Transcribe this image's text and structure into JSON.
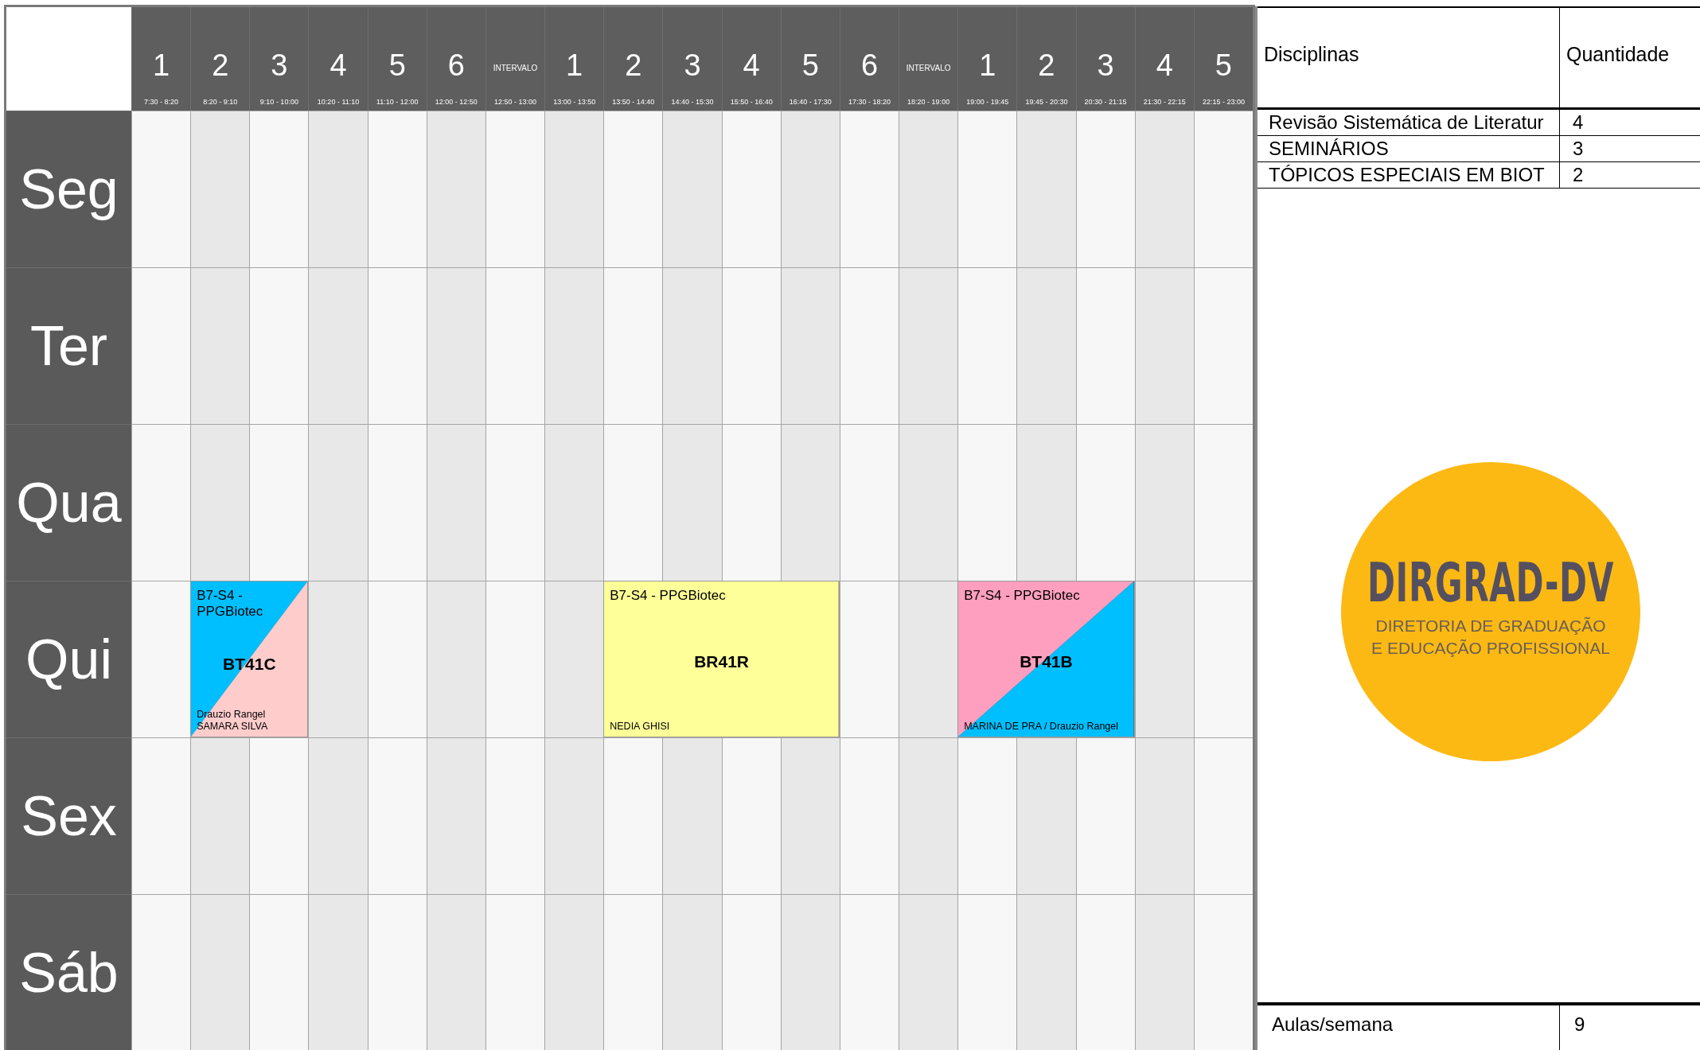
{
  "periods": [
    {
      "kind": "slot",
      "number": "1",
      "time": "7:30 - 8:20"
    },
    {
      "kind": "slot",
      "number": "2",
      "time": "8:20 - 9:10"
    },
    {
      "kind": "slot",
      "number": "3",
      "time": "9:10 - 10:00"
    },
    {
      "kind": "slot",
      "number": "4",
      "time": "10:20 - 11:10"
    },
    {
      "kind": "slot",
      "number": "5",
      "time": "11:10 - 12:00"
    },
    {
      "kind": "slot",
      "number": "6",
      "time": "12:00 - 12:50"
    },
    {
      "kind": "break",
      "label": "INTERVALO",
      "time": "12:50 - 13:00"
    },
    {
      "kind": "slot",
      "number": "1",
      "time": "13:00 - 13:50"
    },
    {
      "kind": "slot",
      "number": "2",
      "time": "13:50 - 14:40"
    },
    {
      "kind": "slot",
      "number": "3",
      "time": "14:40 - 15:30"
    },
    {
      "kind": "slot",
      "number": "4",
      "time": "15:50 - 16:40"
    },
    {
      "kind": "slot",
      "number": "5",
      "time": "16:40 - 17:30"
    },
    {
      "kind": "slot",
      "number": "6",
      "time": "17:30 - 18:20"
    },
    {
      "kind": "break",
      "label": "INTERVALO",
      "time": "18:20 - 19:00"
    },
    {
      "kind": "slot",
      "number": "1",
      "time": "19:00 - 19:45"
    },
    {
      "kind": "slot",
      "number": "2",
      "time": "19:45 - 20:30"
    },
    {
      "kind": "slot",
      "number": "3",
      "time": "20:30 - 21:15"
    },
    {
      "kind": "slot",
      "number": "4",
      "time": "21:30 - 22:15"
    },
    {
      "kind": "slot",
      "number": "5",
      "time": "22:15 - 23:00"
    }
  ],
  "days": [
    {
      "label": "Seg",
      "cells": [
        {
          "kind": "empty"
        },
        {
          "kind": "empty"
        },
        {
          "kind": "empty"
        },
        {
          "kind": "empty"
        },
        {
          "kind": "empty"
        },
        {
          "kind": "empty"
        },
        {
          "kind": "empty"
        },
        {
          "kind": "empty"
        },
        {
          "kind": "empty"
        },
        {
          "kind": "empty"
        },
        {
          "kind": "empty"
        },
        {
          "kind": "empty"
        },
        {
          "kind": "empty"
        },
        {
          "kind": "empty"
        },
        {
          "kind": "empty"
        },
        {
          "kind": "empty"
        },
        {
          "kind": "empty"
        },
        {
          "kind": "empty"
        },
        {
          "kind": "empty"
        }
      ]
    },
    {
      "label": "Ter",
      "cells": [
        {
          "kind": "empty"
        },
        {
          "kind": "empty"
        },
        {
          "kind": "empty"
        },
        {
          "kind": "empty"
        },
        {
          "kind": "empty"
        },
        {
          "kind": "empty"
        },
        {
          "kind": "empty"
        },
        {
          "kind": "empty"
        },
        {
          "kind": "empty"
        },
        {
          "kind": "empty"
        },
        {
          "kind": "empty"
        },
        {
          "kind": "empty"
        },
        {
          "kind": "empty"
        },
        {
          "kind": "empty"
        },
        {
          "kind": "empty"
        },
        {
          "kind": "empty"
        },
        {
          "kind": "empty"
        },
        {
          "kind": "empty"
        },
        {
          "kind": "empty"
        }
      ]
    },
    {
      "label": "Qua",
      "cells": [
        {
          "kind": "empty"
        },
        {
          "kind": "empty"
        },
        {
          "kind": "empty"
        },
        {
          "kind": "empty"
        },
        {
          "kind": "empty"
        },
        {
          "kind": "empty"
        },
        {
          "kind": "empty"
        },
        {
          "kind": "empty"
        },
        {
          "kind": "empty"
        },
        {
          "kind": "empty"
        },
        {
          "kind": "empty"
        },
        {
          "kind": "empty"
        },
        {
          "kind": "empty"
        },
        {
          "kind": "empty"
        },
        {
          "kind": "empty"
        },
        {
          "kind": "empty"
        },
        {
          "kind": "empty"
        },
        {
          "kind": "empty"
        },
        {
          "kind": "empty"
        }
      ]
    },
    {
      "label": "Qui",
      "cells": [
        {
          "kind": "empty"
        },
        {
          "kind": "class",
          "room": "B7-S4 - PPGBiotec",
          "code": "BT41C",
          "teachers": "Drauzio Rangel\nSAMARA SILVA",
          "fills": [
            {
              "color": "#00bfff"
            },
            {
              "color": "#ffcccc"
            }
          ]
        },
        {
          "kind": "continued"
        },
        {
          "kind": "empty"
        },
        {
          "kind": "empty"
        },
        {
          "kind": "empty"
        },
        {
          "kind": "empty"
        },
        {
          "kind": "empty"
        },
        {
          "kind": "class",
          "room": "B7-S4 - PPGBiotec",
          "code": "BR41R",
          "teachers": "NEDIA GHISI",
          "fills": [
            {
              "color": "#ffff99"
            }
          ]
        },
        {
          "kind": "continued"
        },
        {
          "kind": "continued"
        },
        {
          "kind": "continued"
        },
        {
          "kind": "empty"
        },
        {
          "kind": "empty"
        },
        {
          "kind": "class",
          "room": "B7-S4 - PPGBiotec",
          "code": "BT41B",
          "teachers": "MARINA DE PRA / Drauzio Rangel",
          "fills": [
            {
              "color": "#ff9fbf"
            },
            {
              "color": "#00bfff"
            }
          ]
        },
        {
          "kind": "continued"
        },
        {
          "kind": "continued"
        },
        {
          "kind": "empty"
        },
        {
          "kind": "empty"
        }
      ]
    },
    {
      "label": "Sex",
      "cells": [
        {
          "kind": "empty"
        },
        {
          "kind": "empty"
        },
        {
          "kind": "empty"
        },
        {
          "kind": "empty"
        },
        {
          "kind": "empty"
        },
        {
          "kind": "empty"
        },
        {
          "kind": "empty"
        },
        {
          "kind": "empty"
        },
        {
          "kind": "empty"
        },
        {
          "kind": "empty"
        },
        {
          "kind": "empty"
        },
        {
          "kind": "empty"
        },
        {
          "kind": "empty"
        },
        {
          "kind": "empty"
        },
        {
          "kind": "empty"
        },
        {
          "kind": "empty"
        },
        {
          "kind": "empty"
        },
        {
          "kind": "empty"
        },
        {
          "kind": "empty"
        }
      ]
    },
    {
      "label": "Sáb",
      "cells": [
        {
          "kind": "empty"
        },
        {
          "kind": "empty"
        },
        {
          "kind": "empty"
        },
        {
          "kind": "empty"
        },
        {
          "kind": "empty"
        },
        {
          "kind": "empty"
        },
        {
          "kind": "empty"
        },
        {
          "kind": "empty"
        },
        {
          "kind": "empty"
        },
        {
          "kind": "empty"
        },
        {
          "kind": "empty"
        },
        {
          "kind": "empty"
        },
        {
          "kind": "empty"
        },
        {
          "kind": "empty"
        },
        {
          "kind": "empty"
        },
        {
          "kind": "empty"
        },
        {
          "kind": "empty"
        },
        {
          "kind": "empty"
        },
        {
          "kind": "empty"
        }
      ]
    }
  ],
  "subjects": {
    "columns": [
      "Disciplinas",
      "Quantidade"
    ],
    "rows": [
      [
        "Revisão Sistemática de Literatur",
        "4"
      ],
      [
        "SEMINÁRIOS",
        "3"
      ],
      [
        "TÓPICOS ESPECIAIS EM BIOT",
        "2"
      ]
    ],
    "total": {
      "label": "Aulas/semana",
      "value": "9"
    }
  },
  "logo": {
    "title": "DIRGRAD-DV",
    "subtitle_lines": [
      "DIRETORIA DE GRADUAÇÃO",
      "E EDUCAÇÃO PROFISSIONAL"
    ]
  }
}
